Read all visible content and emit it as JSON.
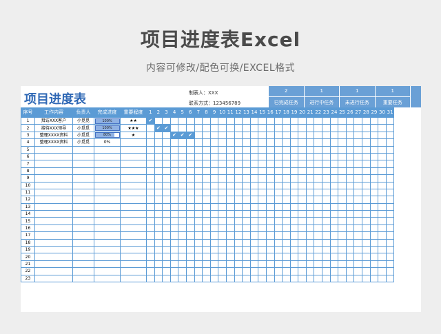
{
  "hero": {
    "title": "项目进度表Excel",
    "subtitle": "内容可修改/配色可换/EXCEL格式"
  },
  "sheet": {
    "title": "项目进度表",
    "maker_label": "制表人：",
    "maker_value": "XXX",
    "contact_label": "联系方式：",
    "contact_value": "123456789"
  },
  "summary": [
    {
      "count": "2",
      "label": "已完成任务"
    },
    {
      "count": "1",
      "label": "进行中任务"
    },
    {
      "count": "1",
      "label": "未进行任务"
    },
    {
      "count": "1",
      "label": "重要任务"
    }
  ],
  "headers": {
    "index": "序号",
    "content": "工作内容",
    "owner": "负责人",
    "progress": "完成进度",
    "importance": "重要程度",
    "days": [
      "1",
      "2",
      "3",
      "4",
      "5",
      "6",
      "7",
      "8",
      "9",
      "10",
      "11",
      "12",
      "13",
      "14",
      "15",
      "16",
      "17",
      "18",
      "19",
      "20",
      "21",
      "22",
      "23",
      "24",
      "25",
      "26",
      "27",
      "28",
      "29",
      "30",
      "31"
    ]
  },
  "tasks": [
    {
      "index": "1",
      "content": "拜访XXX客户",
      "owner": "小觅觅",
      "progress": 1.0,
      "progress_label": "100%",
      "importance": "★★",
      "checked_days": [
        1
      ],
      "show_bar": true
    },
    {
      "index": "2",
      "content": "接待XXX领导",
      "owner": "小觅觅",
      "progress": 1.0,
      "progress_label": "100%",
      "importance": "★★★",
      "checked_days": [
        2,
        3
      ],
      "show_bar": true
    },
    {
      "index": "3",
      "content": "整理XXXX资料",
      "owner": "小觅觅",
      "progress": 0.8,
      "progress_label": "80%",
      "importance": "★",
      "checked_days": [
        4,
        5,
        6
      ],
      "show_bar": true
    },
    {
      "index": "4",
      "content": "整理XXXX资料",
      "owner": "小觅觅",
      "progress": 0.0,
      "progress_label": "0%",
      "importance": "",
      "checked_days": [],
      "show_bar": false
    }
  ],
  "empty_rows": [
    "5",
    "6",
    "7",
    "8",
    "9",
    "10",
    "11",
    "12",
    "13",
    "14",
    "15",
    "16",
    "17",
    "18",
    "19",
    "20",
    "21",
    "22",
    "23"
  ],
  "check_mark": "✔",
  "colors": {
    "accent": "#5b9bd5",
    "summary_bg": "#6aa0d6",
    "title": "#2f68b5",
    "bar_fill": "#8fb1e3"
  }
}
